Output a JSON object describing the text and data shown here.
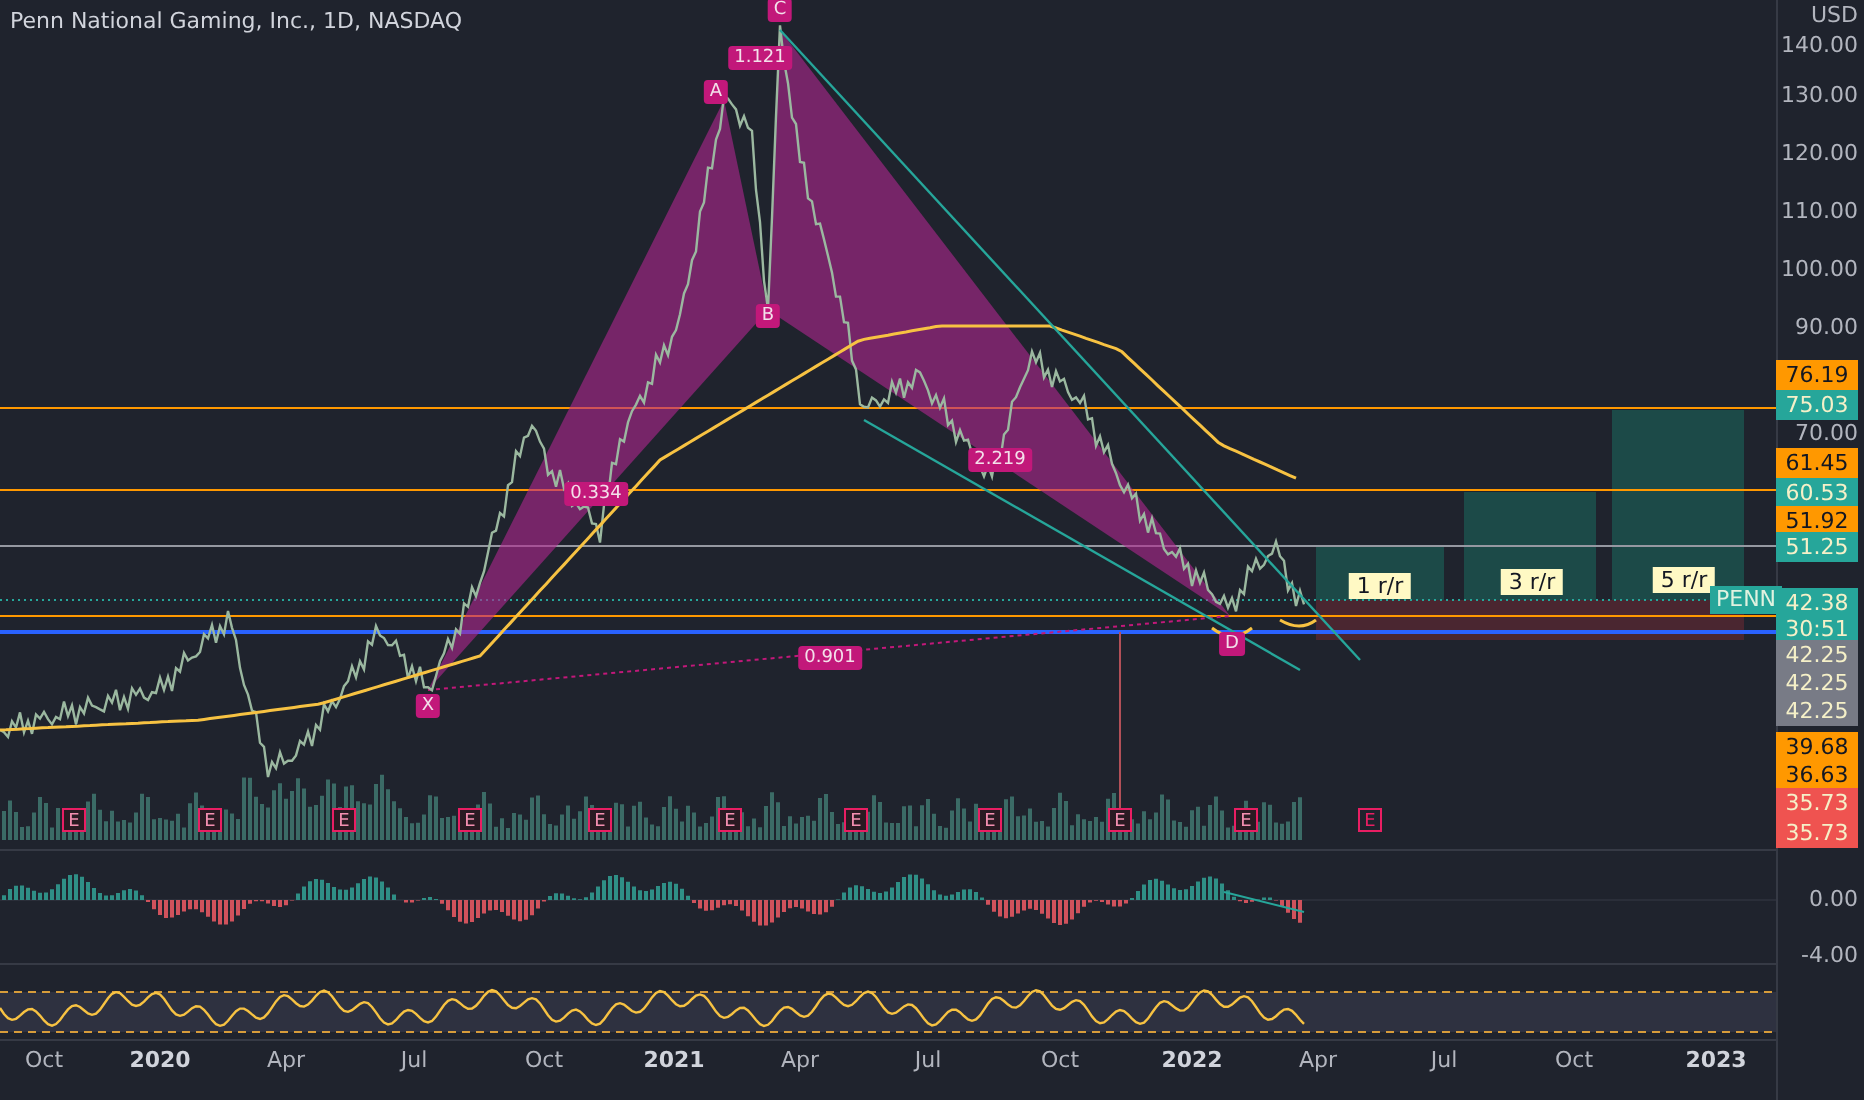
{
  "header": {
    "title": "Penn National Gaming, Inc., 1D, NASDAQ"
  },
  "price_axis": {
    "currency": "USD",
    "ticks": [
      "140.00",
      "130.00",
      "120.00",
      "110.00",
      "100.00",
      "90.00",
      "70.00"
    ]
  },
  "price_tags": [
    {
      "text": "76.19",
      "color": "#ff9800"
    },
    {
      "text": "75.03",
      "color": "#26a69a"
    },
    {
      "text": "61.45",
      "color": "#ff9800"
    },
    {
      "text": "60.53",
      "color": "#26a69a"
    },
    {
      "text": "51.92",
      "color": "#ff9800"
    },
    {
      "text": "51.25",
      "color": "#26a69a"
    },
    {
      "text": "42.38",
      "color": "#26a69a"
    },
    {
      "text": "30:51",
      "color": "#26a69a"
    },
    {
      "text": "42.25",
      "color": "#787b86"
    },
    {
      "text": "42.25",
      "color": "#787b86"
    },
    {
      "text": "42.25",
      "color": "#787b86"
    },
    {
      "text": "39.68",
      "color": "#ff9800"
    },
    {
      "text": "36.63",
      "color": "#ff9800"
    },
    {
      "text": "35.73",
      "color": "#ef5350"
    },
    {
      "text": "35.73",
      "color": "#ef5350"
    }
  ],
  "symbol_tag": {
    "text": "PENN"
  },
  "pattern_points": [
    "X",
    "A",
    "B",
    "C",
    "D"
  ],
  "ratios": [
    "1.121",
    "0.334",
    "2.219",
    "0.901"
  ],
  "risk_reward": [
    "1 r/r",
    "3 r/r",
    "5 r/r"
  ],
  "earnings": [
    {
      "label": "E",
      "kind": "past"
    },
    {
      "label": "E",
      "kind": "past"
    },
    {
      "label": "E",
      "kind": "past"
    },
    {
      "label": "E",
      "kind": "past"
    },
    {
      "label": "E",
      "kind": "past"
    },
    {
      "label": "E",
      "kind": "past"
    },
    {
      "label": "E",
      "kind": "past"
    },
    {
      "label": "E",
      "kind": "past"
    },
    {
      "label": "E",
      "kind": "past"
    },
    {
      "label": "E",
      "kind": "past"
    },
    {
      "label": "E",
      "kind": "upcoming"
    }
  ],
  "macd_axis": [
    "0.00",
    "-4.00"
  ],
  "time_axis": [
    {
      "label": "Oct",
      "kind": "month"
    },
    {
      "label": "2020",
      "kind": "year"
    },
    {
      "label": "Apr",
      "kind": "month"
    },
    {
      "label": "Jul",
      "kind": "month"
    },
    {
      "label": "Oct",
      "kind": "month"
    },
    {
      "label": "2021",
      "kind": "year"
    },
    {
      "label": "Apr",
      "kind": "month"
    },
    {
      "label": "Jul",
      "kind": "month"
    },
    {
      "label": "Oct",
      "kind": "month"
    },
    {
      "label": "2022",
      "kind": "year"
    },
    {
      "label": "Apr",
      "kind": "month"
    },
    {
      "label": "Jul",
      "kind": "month"
    },
    {
      "label": "Oct",
      "kind": "month"
    },
    {
      "label": "2023",
      "kind": "year"
    }
  ]
}
